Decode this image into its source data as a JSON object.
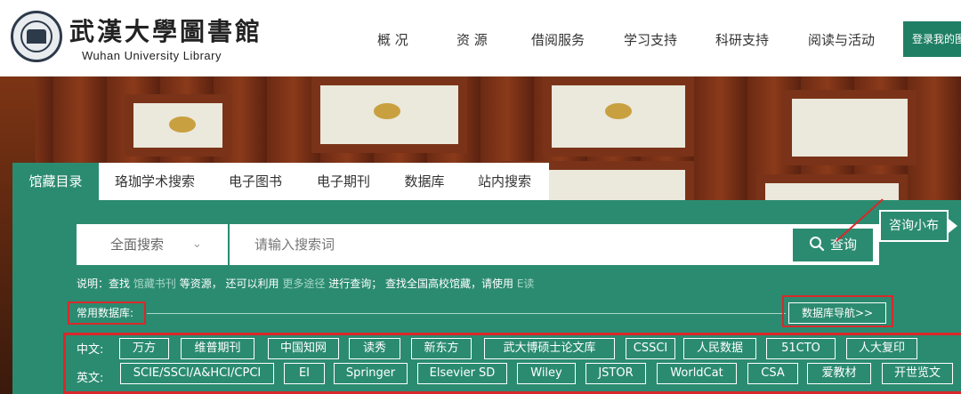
{
  "header": {
    "logo_cn": "武漢大學圖書館",
    "logo_en": "Wuhan University Library",
    "nav": [
      "概 况",
      "资 源",
      "借阅服务",
      "学习支持",
      "科研支持",
      "阅读与活动"
    ],
    "login_label": "登录我的图书馆"
  },
  "tabs": [
    "馆藏目录",
    "珞珈学术搜索",
    "电子图书",
    "电子期刊",
    "数据库",
    "站内搜索"
  ],
  "search": {
    "scope": "全面搜索",
    "placeholder": "请输入搜索词",
    "button": "查询"
  },
  "consult": {
    "label": "咨询小布"
  },
  "notice": {
    "p1": "说明：查找",
    "link1": "馆藏书刊",
    "p2": "等资源，  还可以利用",
    "link2": "更多途径",
    "p3": "进行查询；  查找全国高校馆藏，请使用",
    "link3": "E读"
  },
  "databases": {
    "label": "常用数据库:",
    "nav_button": "数据库导航>>",
    "cn_label": "中文:",
    "en_label": "英文:",
    "cn": [
      "万方",
      "维普期刊",
      "中国知网",
      "读秀",
      "新东方",
      "武大博硕士论文库",
      "CSSCI",
      "人民数据",
      "51CTO",
      "人大复印"
    ],
    "en": [
      "SCIE/SSCI/A&HCI/CPCI",
      "EI",
      "Springer",
      "Elsevier SD",
      "Wiley",
      "JSTOR",
      "WorldCat",
      "CSA",
      "爱教材",
      "开世览文"
    ]
  },
  "colors": {
    "accent": "#2b8b70",
    "highlight": "#d9282b"
  }
}
